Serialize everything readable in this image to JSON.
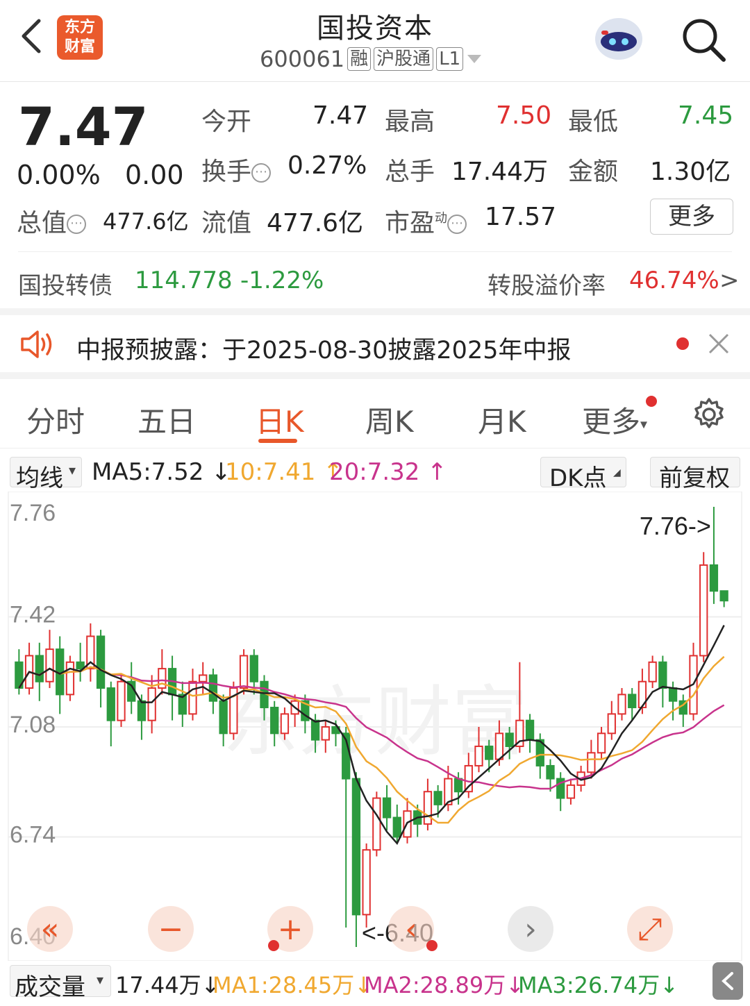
{
  "header": {
    "logo_line1": "东方",
    "logo_line2": "财富",
    "title": "国投资本",
    "code": "600061",
    "tags": [
      "融",
      "沪股通",
      "L1"
    ]
  },
  "quote": {
    "price": "7.47",
    "change_pct": "0.00%",
    "change": "0.00",
    "open_label": "今开",
    "open": "7.47",
    "high_label": "最高",
    "high": "7.50",
    "low_label": "最低",
    "low": "7.45",
    "turnover_label": "换手",
    "turnover": "0.27%",
    "volume_label": "总手",
    "volume": "17.44万",
    "amount_label": "金额",
    "amount": "1.30亿",
    "mktcap_label": "总值",
    "mktcap": "477.6亿",
    "float_label": "流值",
    "float": "477.6亿",
    "pe_label": "市盈",
    "pe_sup": "动",
    "pe": "17.57",
    "more_label": "更多"
  },
  "bond": {
    "name": "国投转债",
    "price": "114.778",
    "change": "-1.22%",
    "premium_label": "转股溢价率",
    "premium": "46.74%",
    "arrow": ">"
  },
  "notice": {
    "text": "中报预披露：于2025-08-30披露2025年中报"
  },
  "tabs": [
    "分时",
    "五日",
    "日K",
    "周K",
    "月K",
    "更多"
  ],
  "ma": {
    "selector": "均线",
    "ma5": "MA5:7.52",
    "ma10": "10:7.41",
    "ma20": "20:7.32",
    "dk": "DK点",
    "adjust": "前复权"
  },
  "colors": {
    "up": "#e03030",
    "down": "#2c9a3f",
    "ma5": "#222222",
    "ma10": "#f0a830",
    "ma20": "#c8338c",
    "accent": "#e8572a"
  },
  "chart_data": {
    "type": "candlestick",
    "y_ticks": [
      "7.76",
      "7.42",
      "7.08",
      "6.74",
      "6.40"
    ],
    "ylim": [
      6.4,
      7.76
    ],
    "max_label": "7.76->",
    "min_label": "<-6.40",
    "watermark": "东方财富",
    "candles": [
      [
        7.28,
        7.2,
        7.32,
        7.18
      ],
      [
        7.2,
        7.3,
        7.34,
        7.18
      ],
      [
        7.3,
        7.22,
        7.34,
        7.16
      ],
      [
        7.22,
        7.32,
        7.38,
        7.2
      ],
      [
        7.32,
        7.18,
        7.36,
        7.12
      ],
      [
        7.18,
        7.28,
        7.3,
        7.16
      ],
      [
        7.28,
        7.26,
        7.34,
        7.22
      ],
      [
        7.26,
        7.36,
        7.4,
        7.22
      ],
      [
        7.36,
        7.2,
        7.38,
        7.14
      ],
      [
        7.2,
        7.1,
        7.22,
        7.02
      ],
      [
        7.1,
        7.22,
        7.24,
        7.08
      ],
      [
        7.22,
        7.16,
        7.28,
        7.12
      ],
      [
        7.16,
        7.1,
        7.18,
        7.04
      ],
      [
        7.1,
        7.2,
        7.24,
        7.06
      ],
      [
        7.2,
        7.26,
        7.32,
        7.18
      ],
      [
        7.26,
        7.18,
        7.3,
        7.1
      ],
      [
        7.18,
        7.12,
        7.22,
        7.08
      ],
      [
        7.12,
        7.22,
        7.26,
        7.1
      ],
      [
        7.22,
        7.24,
        7.28,
        7.18
      ],
      [
        7.24,
        7.16,
        7.26,
        7.12
      ],
      [
        7.16,
        7.06,
        7.18,
        7.02
      ],
      [
        7.06,
        7.2,
        7.22,
        7.04
      ],
      [
        7.2,
        7.3,
        7.32,
        7.18
      ],
      [
        7.3,
        7.22,
        7.32,
        7.18
      ],
      [
        7.22,
        7.14,
        7.24,
        7.1
      ],
      [
        7.14,
        7.06,
        7.16,
        7.02
      ],
      [
        7.06,
        7.12,
        7.14,
        7.04
      ],
      [
        7.12,
        7.16,
        7.18,
        7.08
      ],
      [
        7.16,
        7.1,
        7.18,
        7.06
      ],
      [
        7.1,
        7.04,
        7.12,
        7.0
      ],
      [
        7.04,
        7.08,
        7.1,
        7.0
      ],
      [
        7.08,
        7.06,
        7.1,
        7.02
      ],
      [
        7.06,
        6.92,
        7.08,
        6.46
      ],
      [
        6.92,
        6.5,
        6.94,
        6.4
      ],
      [
        6.5,
        6.7,
        6.72,
        6.46
      ],
      [
        6.7,
        6.86,
        6.88,
        6.68
      ],
      [
        6.86,
        6.8,
        6.9,
        6.76
      ],
      [
        6.8,
        6.74,
        6.84,
        6.72
      ],
      [
        6.74,
        6.82,
        6.86,
        6.72
      ],
      [
        6.82,
        6.78,
        6.84,
        6.74
      ],
      [
        6.78,
        6.88,
        6.92,
        6.76
      ],
      [
        6.88,
        6.84,
        6.9,
        6.8
      ],
      [
        6.84,
        6.92,
        6.96,
        6.82
      ],
      [
        6.92,
        6.88,
        6.94,
        6.84
      ],
      [
        6.88,
        6.96,
        7.0,
        6.86
      ],
      [
        6.96,
        7.02,
        7.08,
        6.94
      ],
      [
        7.02,
        6.98,
        7.04,
        6.94
      ],
      [
        6.98,
        7.06,
        7.1,
        6.96
      ],
      [
        7.06,
        7.02,
        7.08,
        6.98
      ],
      [
        7.02,
        7.1,
        7.28,
        7.0
      ],
      [
        7.1,
        7.04,
        7.12,
        7.0
      ],
      [
        7.04,
        6.96,
        7.06,
        6.92
      ],
      [
        6.96,
        6.92,
        6.98,
        6.88
      ],
      [
        6.92,
        6.86,
        6.94,
        6.82
      ],
      [
        6.86,
        6.9,
        6.92,
        6.84
      ],
      [
        6.9,
        6.94,
        6.96,
        6.88
      ],
      [
        6.94,
        7.0,
        7.04,
        6.92
      ],
      [
        7.0,
        7.06,
        7.08,
        6.98
      ],
      [
        7.06,
        7.12,
        7.16,
        7.04
      ],
      [
        7.12,
        7.18,
        7.2,
        7.1
      ],
      [
        7.18,
        7.14,
        7.2,
        7.1
      ],
      [
        7.14,
        7.22,
        7.26,
        7.12
      ],
      [
        7.22,
        7.28,
        7.3,
        7.2
      ],
      [
        7.28,
        7.2,
        7.3,
        7.14
      ],
      [
        7.2,
        7.16,
        7.22,
        7.1
      ],
      [
        7.16,
        7.12,
        7.18,
        7.08
      ],
      [
        7.12,
        7.3,
        7.34,
        7.1
      ],
      [
        7.3,
        7.58,
        7.62,
        7.28
      ],
      [
        7.58,
        7.5,
        7.76,
        7.46
      ],
      [
        7.5,
        7.47,
        7.5,
        7.45
      ]
    ]
  },
  "chart_controls": [
    "double-left-icon",
    "zoom-out-icon",
    "zoom-in-icon",
    "left-icon",
    "right-icon",
    "expand-icon"
  ],
  "volume": {
    "selector": "成交量",
    "value": "17.44万",
    "ma1": "MA1:28.45万",
    "ma2": "MA2:28.89万",
    "ma3": "MA3:26.74万"
  }
}
